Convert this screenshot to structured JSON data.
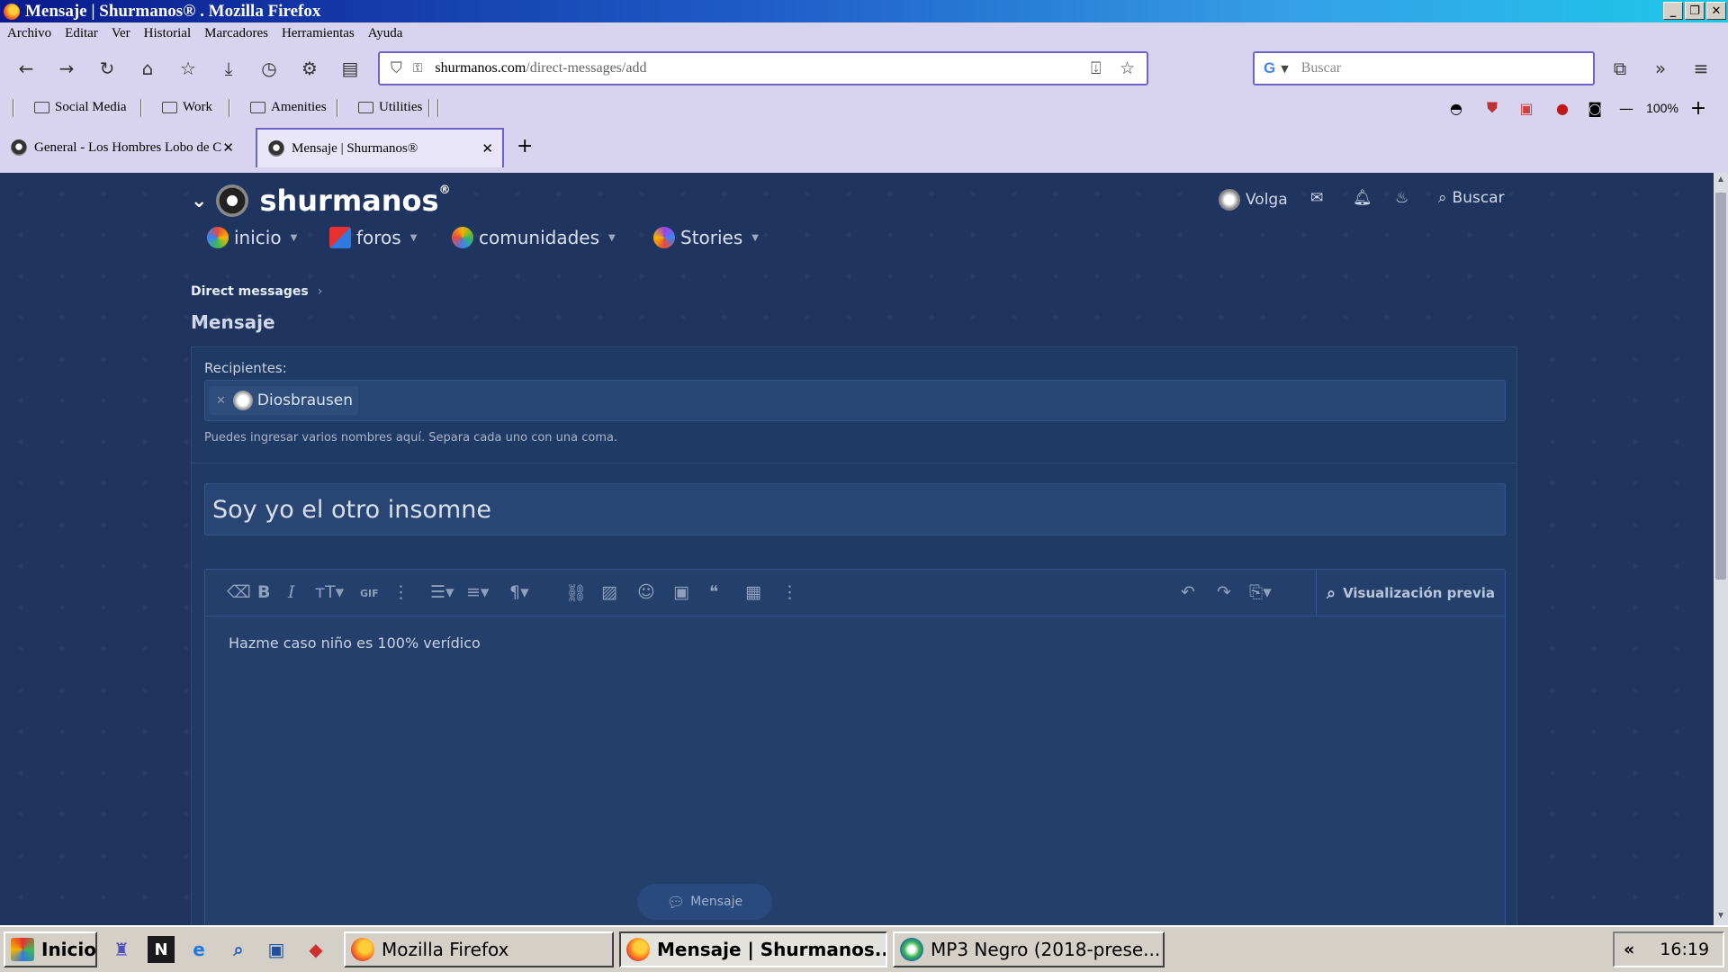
{
  "window": {
    "title": "Mensaje | Shurmanos® . Mozilla Firefox"
  },
  "menu": [
    "Archivo",
    "Editar",
    "Ver",
    "Historial",
    "Marcadores",
    "Herramientas",
    "Ayuda"
  ],
  "url": {
    "host": "shurmanos.com",
    "path": "/direct-messages/add"
  },
  "search": {
    "engine": "G",
    "placeholder": "Buscar"
  },
  "bookmarks": [
    "Social Media",
    "Work",
    "Amenities",
    "Utilities"
  ],
  "zoom": "100%",
  "tabs": [
    {
      "title": "General - Los Hombres Lobo de Castronegro",
      "active": false
    },
    {
      "title": "Mensaje | Shurmanos®",
      "active": true
    }
  ],
  "site": {
    "brand": "shurmanos",
    "brand_mark": "®",
    "user": "Volga",
    "search_label": "Buscar",
    "nav": [
      "inicio",
      "foros",
      "comunidades",
      "Stories"
    ],
    "breadcrumb": "Direct messages",
    "page_title": "Mensaje"
  },
  "form": {
    "recipients_label": "Recipientes:",
    "recipient_name": "Diosbrausen",
    "recipients_hint": "Puedes ingresar varios nombres aquí. Separa cada uno con una coma.",
    "subject": "Soy yo el otro insomne",
    "body": "Hazme caso niño es 100% verídico",
    "preview_label": "Visualización previa",
    "submit_label": "Mensaje"
  },
  "taskbar": {
    "start": "Inicio",
    "windows": [
      "Mozilla Firefox",
      "Mensaje | Shurmanos...",
      "MP3 Negro (2018-prese..."
    ],
    "clock": "16:19"
  }
}
